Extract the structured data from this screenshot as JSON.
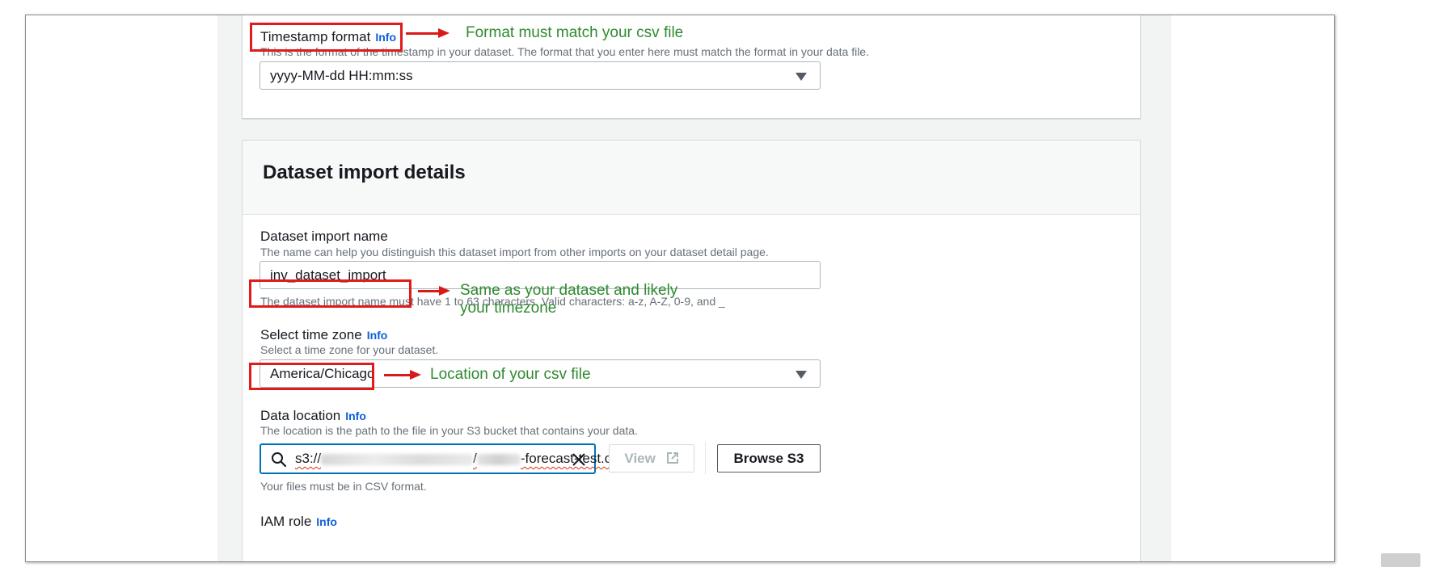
{
  "timestamp_format": {
    "label": "Timestamp format",
    "info": "Info",
    "description": "This is the format of the timestamp in your dataset. The format that you enter here must match the format in your data file.",
    "value": "yyyy-MM-dd HH:mm:ss"
  },
  "import_details": {
    "title": "Dataset import details",
    "import_name": {
      "label": "Dataset import name",
      "description": "The name can help you distinguish this dataset import from other imports on your dataset detail page.",
      "value": "inv_dataset_import",
      "constraint": "The dataset import name must have 1 to 63 characters. Valid characters: a-z, A-Z, 0-9, and _"
    },
    "time_zone": {
      "label": "Select time zone",
      "info": "Info",
      "description": "Select a time zone for your dataset.",
      "value": "America/Chicago"
    },
    "data_location": {
      "label": "Data location",
      "info": "Info",
      "description": "The location is the path to the file in your S3 bucket that contains your data.",
      "value_prefix": "s3://",
      "value_sep": "/",
      "value_suffix": "-forecast-test.csv",
      "hint": "Your files must be in CSV format.",
      "view_button": "View",
      "browse_button": "Browse S3"
    },
    "iam_role": {
      "label": "IAM role",
      "info": "Info"
    }
  },
  "annotations": {
    "timestamp_note": "Format must match your csv file",
    "timezone_note_line1": "Same as your dataset and likely",
    "timezone_note_line2": "your timezone",
    "location_note": "Location of your csv file"
  },
  "colors": {
    "annotation_red": "#e01b1b",
    "annotation_green": "#2f8a2f",
    "info_link": "#0b5fd8",
    "focus_border": "#0073bb"
  }
}
